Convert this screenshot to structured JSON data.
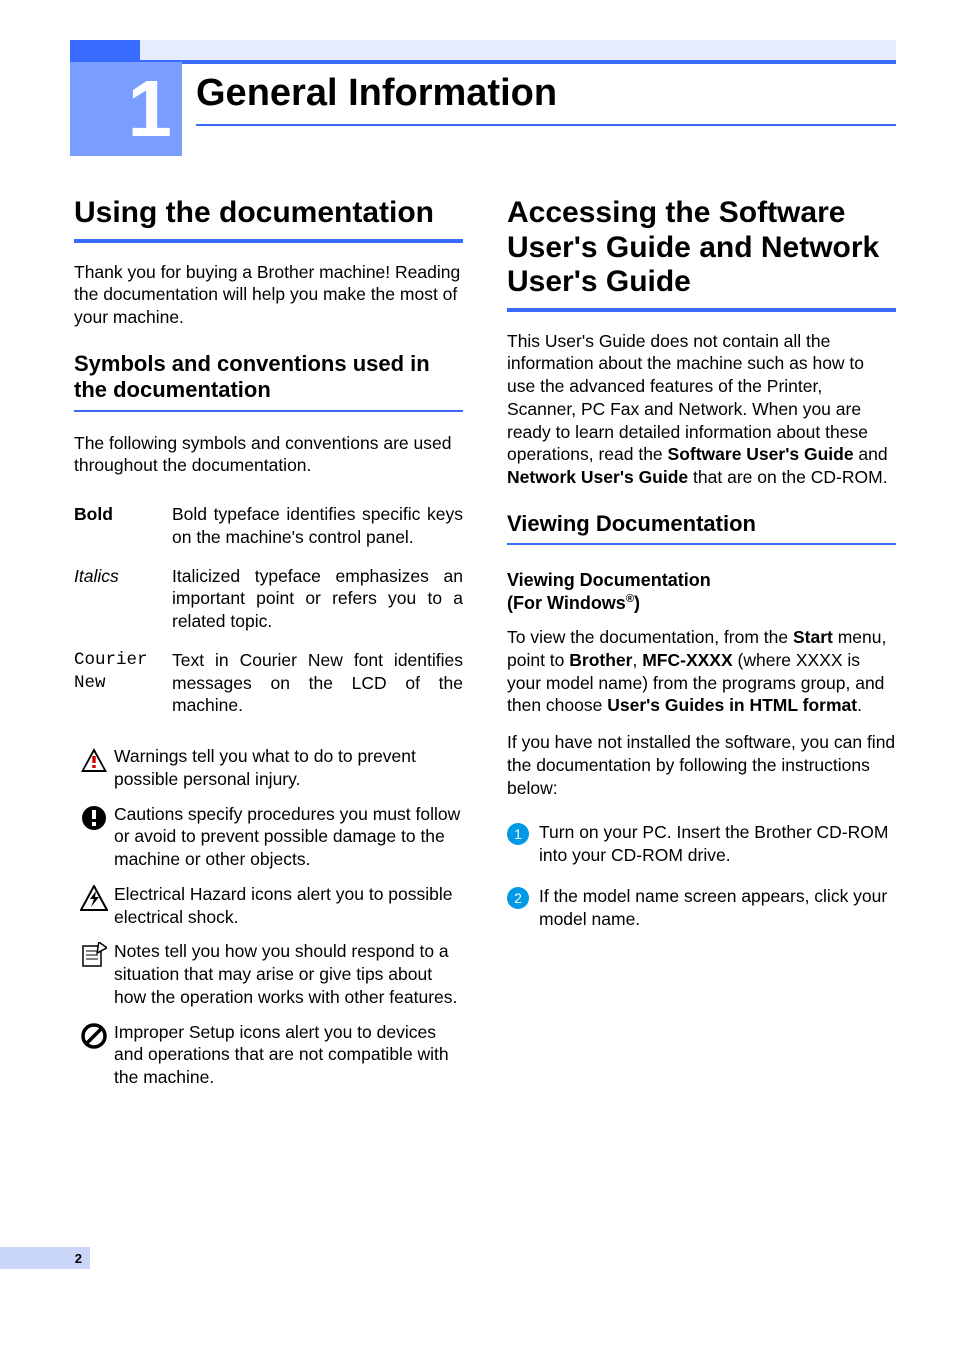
{
  "chapter": {
    "number": "1",
    "title": "General Information"
  },
  "page_number": "2",
  "left": {
    "h2": "Using the documentation",
    "intro": "Thank you for buying a Brother machine! Reading the documentation will help you make the most of your machine.",
    "h3": "Symbols and conventions used in the documentation",
    "conv_intro": "The following symbols and conventions are used throughout the documentation.",
    "conventions": [
      {
        "term": "Bold",
        "term_style": "bold",
        "def": "Bold typeface identifies specific keys on the machine's control panel."
      },
      {
        "term": "Italics",
        "term_style": "italic",
        "def": "Italicized typeface emphasizes an important point or refers you to a related topic."
      },
      {
        "term": "Courier New",
        "term_style": "mono",
        "def": "Text in Courier New font identifies messages on the LCD of the machine."
      }
    ],
    "icons": [
      {
        "name": "warning-icon",
        "text": "Warnings tell you what to do to prevent possible personal injury."
      },
      {
        "name": "caution-icon",
        "text": "Cautions specify procedures you must follow or avoid to prevent possible damage to the machine or other objects."
      },
      {
        "name": "electrical-hazard-icon",
        "text": "Electrical Hazard icons alert you to possible electrical shock."
      },
      {
        "name": "note-icon",
        "text": "Notes tell you how you should respond to a situation that may arise or give tips about how the operation works with other features."
      },
      {
        "name": "improper-setup-icon",
        "text": "Improper Setup icons alert you to devices and operations that are not compatible with the machine."
      }
    ]
  },
  "right": {
    "h2": "Accessing the Software User's Guide and Network User's Guide",
    "intro_pre": "This User's Guide does not contain all the information about the machine such as how to use the advanced features of the Printer, Scanner, PC Fax and Network. When you are ready to learn detailed information about these operations, read the ",
    "sug": "Software User's Guide",
    "intro_and": " and ",
    "nug": "Network User's Guide",
    "intro_post": " that are on the CD-ROM.",
    "h3": "Viewing Documentation",
    "h4_line1": "Viewing Documentation",
    "h4_line2_pre": "(For Windows",
    "h4_line2_post": ")",
    "p1_a": "To view the documentation, from the ",
    "start": "Start",
    "p1_b": " menu, point to ",
    "brother": "Brother",
    "p1_c": ", ",
    "mfc": "MFC-XXXX",
    "p1_d": " (where XXXX is your model name) from the programs group, and then choose ",
    "ughtml": "User's Guides in HTML format",
    "p1_e": ".",
    "p2": "If you have not installed the software, you can find the documentation by following the instructions below:",
    "steps": [
      {
        "n": "1",
        "text": "Turn on your PC. Insert the Brother CD-ROM into your CD-ROM drive."
      },
      {
        "n": "2",
        "text": "If the model name screen appears, click your model name."
      }
    ]
  }
}
